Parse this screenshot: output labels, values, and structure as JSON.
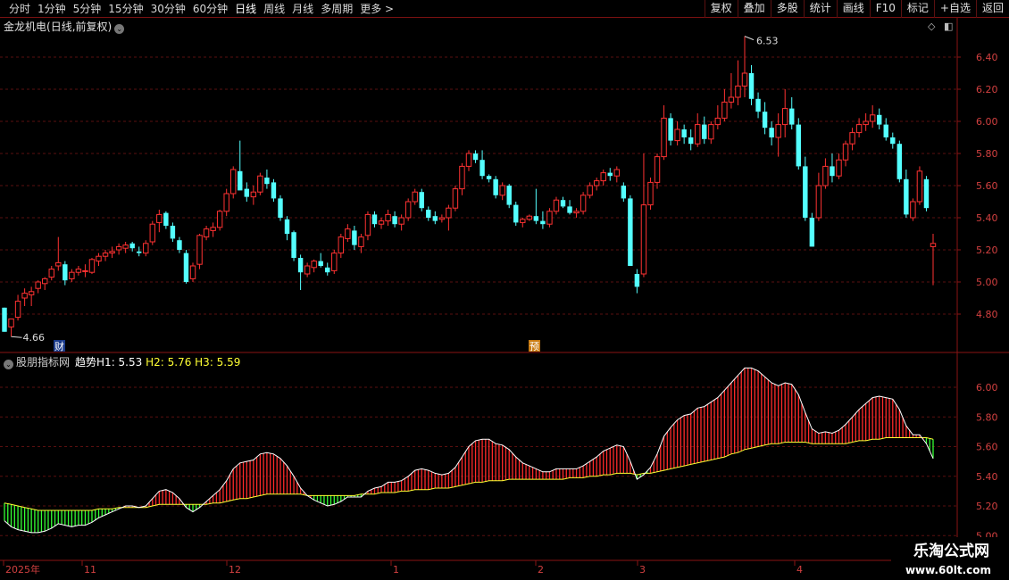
{
  "toolbar": {
    "periods": [
      "分时",
      "1分钟",
      "5分钟",
      "15分钟",
      "30分钟",
      "60分钟",
      "日线",
      "周线",
      "月线",
      "多周期",
      "更多 >"
    ],
    "active_period": "日线",
    "actions": [
      "复权",
      "叠加",
      "多股",
      "统计",
      "画线",
      "F10",
      "标记",
      "+自选",
      "返回"
    ]
  },
  "stock": {
    "name": "金龙机电",
    "title_suffix": "(日线,前复权)"
  },
  "main_chart": {
    "y_ticks": [
      "6.40",
      "6.20",
      "6.00",
      "5.80",
      "5.60",
      "5.40",
      "5.20",
      "5.00",
      "4.80"
    ],
    "high_label": "6.53",
    "low_label": "4.66",
    "badge_cai": "财",
    "badge_yu": "预",
    "up_color": "#ff3232",
    "down_color": "#54ffff"
  },
  "indicator": {
    "name": "股朋指标网",
    "trend_label": "趋势",
    "h1": "H1: 5.53",
    "h2": "H2: 5.76",
    "h3": "H3: 5.59",
    "y_ticks": [
      "6.00",
      "5.80",
      "5.60",
      "5.40",
      "5.20",
      "5.00"
    ],
    "rise_color": "#ff2a2a",
    "fall_color": "#33ff33",
    "h2_color": "#ffffff",
    "h3_color": "#ffff33"
  },
  "x_axis": {
    "labels": [
      "2025年",
      "11",
      "12",
      "1",
      "2",
      "3",
      "4"
    ]
  },
  "watermark": {
    "title": "乐淘公式网",
    "url": "www.60lt.com"
  },
  "chart_data": {
    "type": "candlestick",
    "ohlc": [
      [
        4.84,
        4.84,
        4.69,
        4.69
      ],
      [
        4.72,
        4.77,
        4.66,
        4.77
      ],
      [
        4.78,
        4.92,
        4.76,
        4.88
      ],
      [
        4.9,
        4.96,
        4.85,
        4.93
      ],
      [
        4.92,
        4.97,
        4.85,
        4.94
      ],
      [
        4.96,
        5.01,
        4.93,
        5.0
      ],
      [
        4.99,
        5.03,
        4.95,
        5.02
      ],
      [
        5.03,
        5.1,
        5.01,
        5.08
      ],
      [
        5.1,
        5.28,
        5.07,
        5.12
      ],
      [
        5.11,
        5.13,
        4.98,
        5.01
      ],
      [
        5.02,
        5.08,
        5.0,
        5.06
      ],
      [
        5.06,
        5.1,
        5.04,
        5.08
      ],
      [
        5.07,
        5.11,
        5.03,
        5.07
      ],
      [
        5.06,
        5.15,
        5.05,
        5.14
      ],
      [
        5.13,
        5.18,
        5.1,
        5.16
      ],
      [
        5.16,
        5.2,
        5.13,
        5.18
      ],
      [
        5.18,
        5.22,
        5.15,
        5.19
      ],
      [
        5.2,
        5.24,
        5.17,
        5.22
      ],
      [
        5.21,
        5.25,
        5.18,
        5.23
      ],
      [
        5.24,
        5.25,
        5.19,
        5.21
      ],
      [
        5.19,
        5.22,
        5.16,
        5.18
      ],
      [
        5.18,
        5.26,
        5.16,
        5.24
      ],
      [
        5.25,
        5.38,
        5.23,
        5.36
      ],
      [
        5.37,
        5.45,
        5.31,
        5.42
      ],
      [
        5.43,
        5.44,
        5.33,
        5.35
      ],
      [
        5.35,
        5.37,
        5.25,
        5.27
      ],
      [
        5.26,
        5.28,
        5.18,
        5.2
      ],
      [
        5.18,
        5.2,
        4.99,
        5.0
      ],
      [
        5.02,
        5.12,
        5.0,
        5.1
      ],
      [
        5.11,
        5.3,
        5.08,
        5.29
      ],
      [
        5.28,
        5.35,
        5.26,
        5.33
      ],
      [
        5.32,
        5.37,
        5.28,
        5.34
      ],
      [
        5.34,
        5.45,
        5.32,
        5.44
      ],
      [
        5.44,
        5.58,
        5.41,
        5.55
      ],
      [
        5.55,
        5.72,
        5.52,
        5.7
      ],
      [
        5.69,
        5.88,
        5.59,
        5.57
      ],
      [
        5.58,
        5.62,
        5.5,
        5.53
      ],
      [
        5.53,
        5.6,
        5.48,
        5.56
      ],
      [
        5.56,
        5.68,
        5.54,
        5.66
      ],
      [
        5.65,
        5.7,
        5.58,
        5.61
      ],
      [
        5.62,
        5.64,
        5.5,
        5.52
      ],
      [
        5.52,
        5.54,
        5.38,
        5.4
      ],
      [
        5.39,
        5.41,
        5.26,
        5.3
      ],
      [
        5.31,
        5.32,
        5.13,
        5.15
      ],
      [
        5.15,
        5.17,
        4.95,
        5.06
      ],
      [
        5.05,
        5.12,
        5.03,
        5.1
      ],
      [
        5.09,
        5.14,
        5.06,
        5.13
      ],
      [
        5.13,
        5.18,
        5.09,
        5.1
      ],
      [
        5.09,
        5.12,
        5.04,
        5.06
      ],
      [
        5.07,
        5.2,
        5.05,
        5.18
      ],
      [
        5.18,
        5.3,
        5.15,
        5.28
      ],
      [
        5.27,
        5.36,
        5.25,
        5.33
      ],
      [
        5.32,
        5.35,
        5.2,
        5.23
      ],
      [
        5.22,
        5.3,
        5.18,
        5.28
      ],
      [
        5.29,
        5.44,
        5.26,
        5.42
      ],
      [
        5.42,
        5.44,
        5.34,
        5.36
      ],
      [
        5.36,
        5.4,
        5.33,
        5.38
      ],
      [
        5.38,
        5.45,
        5.35,
        5.42
      ],
      [
        5.41,
        5.44,
        5.34,
        5.36
      ],
      [
        5.36,
        5.42,
        5.32,
        5.4
      ],
      [
        5.4,
        5.52,
        5.38,
        5.5
      ],
      [
        5.5,
        5.58,
        5.48,
        5.56
      ],
      [
        5.56,
        5.58,
        5.44,
        5.46
      ],
      [
        5.45,
        5.47,
        5.38,
        5.4
      ],
      [
        5.41,
        5.44,
        5.36,
        5.38
      ],
      [
        5.39,
        5.42,
        5.37,
        5.4
      ],
      [
        5.4,
        5.48,
        5.32,
        5.46
      ],
      [
        5.46,
        5.6,
        5.44,
        5.58
      ],
      [
        5.58,
        5.74,
        5.54,
        5.72
      ],
      [
        5.72,
        5.82,
        5.69,
        5.8
      ],
      [
        5.8,
        5.82,
        5.74,
        5.76
      ],
      [
        5.76,
        5.82,
        5.64,
        5.66
      ],
      [
        5.66,
        5.67,
        5.62,
        5.64
      ],
      [
        5.64,
        5.66,
        5.52,
        5.54
      ],
      [
        5.54,
        5.62,
        5.51,
        5.6
      ],
      [
        5.6,
        5.61,
        5.46,
        5.48
      ],
      [
        5.48,
        5.5,
        5.35,
        5.37
      ],
      [
        5.37,
        5.4,
        5.34,
        5.39
      ],
      [
        5.39,
        5.42,
        5.38,
        5.41
      ],
      [
        5.41,
        5.58,
        5.36,
        5.38
      ],
      [
        5.38,
        5.44,
        5.33,
        5.36
      ],
      [
        5.36,
        5.46,
        5.34,
        5.44
      ],
      [
        5.44,
        5.53,
        5.42,
        5.51
      ],
      [
        5.51,
        5.53,
        5.46,
        5.47
      ],
      [
        5.47,
        5.51,
        5.42,
        5.43
      ],
      [
        5.43,
        5.46,
        5.4,
        5.44
      ],
      [
        5.44,
        5.56,
        5.42,
        5.54
      ],
      [
        5.54,
        5.62,
        5.52,
        5.6
      ],
      [
        5.6,
        5.65,
        5.57,
        5.63
      ],
      [
        5.63,
        5.7,
        5.6,
        5.68
      ],
      [
        5.68,
        5.71,
        5.63,
        5.66
      ],
      [
        5.66,
        5.72,
        5.62,
        5.7
      ],
      [
        5.6,
        5.62,
        5.5,
        5.52
      ],
      [
        5.52,
        5.54,
        5.1,
        5.1
      ],
      [
        5.05,
        5.08,
        4.93,
        4.97
      ],
      [
        5.05,
        5.8,
        5.03,
        5.48
      ],
      [
        5.48,
        5.65,
        5.45,
        5.62
      ],
      [
        5.62,
        5.8,
        5.58,
        5.78
      ],
      [
        5.78,
        6.1,
        5.76,
        6.02
      ],
      [
        6.02,
        6.05,
        5.85,
        5.88
      ],
      [
        5.88,
        6.0,
        5.85,
        5.95
      ],
      [
        5.95,
        5.98,
        5.86,
        5.9
      ],
      [
        5.9,
        5.95,
        5.82,
        5.86
      ],
      [
        5.86,
        6.05,
        5.84,
        5.98
      ],
      [
        5.98,
        6.03,
        5.86,
        5.89
      ],
      [
        5.89,
        6.0,
        5.86,
        5.98
      ],
      [
        5.98,
        6.1,
        5.95,
        6.02
      ],
      [
        6.02,
        6.2,
        6.0,
        6.12
      ],
      [
        6.12,
        6.3,
        6.08,
        6.15
      ],
      [
        6.15,
        6.38,
        6.1,
        6.22
      ],
      [
        6.22,
        6.53,
        6.15,
        6.3
      ],
      [
        6.3,
        6.35,
        6.1,
        6.14
      ],
      [
        6.14,
        6.18,
        6.02,
        6.06
      ],
      [
        6.06,
        6.12,
        5.92,
        5.96
      ],
      [
        5.96,
        6.0,
        5.85,
        5.9
      ],
      [
        5.9,
        6.05,
        5.78,
        5.98
      ],
      [
        5.98,
        6.2,
        5.9,
        6.08
      ],
      [
        6.08,
        6.15,
        5.95,
        5.98
      ],
      [
        5.98,
        6.02,
        5.7,
        5.72
      ],
      [
        5.72,
        5.78,
        5.38,
        5.4
      ],
      [
        5.4,
        5.43,
        5.22,
        5.22
      ],
      [
        5.4,
        5.68,
        5.38,
        5.6
      ],
      [
        5.6,
        5.77,
        5.58,
        5.72
      ],
      [
        5.72,
        5.8,
        5.62,
        5.66
      ],
      [
        5.66,
        5.8,
        5.64,
        5.76
      ],
      [
        5.76,
        5.88,
        5.72,
        5.86
      ],
      [
        5.86,
        5.96,
        5.82,
        5.93
      ],
      [
        5.93,
        6.02,
        5.9,
        5.98
      ],
      [
        5.98,
        6.05,
        5.94,
        6.0
      ],
      [
        6.0,
        6.1,
        5.96,
        6.04
      ],
      [
        6.04,
        6.08,
        5.95,
        5.98
      ],
      [
        5.98,
        6.02,
        5.88,
        5.9
      ],
      [
        5.9,
        5.93,
        5.83,
        5.86
      ],
      [
        5.86,
        5.88,
        5.62,
        5.64
      ],
      [
        5.64,
        5.7,
        5.4,
        5.42
      ],
      [
        5.4,
        5.52,
        5.38,
        5.5
      ],
      [
        5.5,
        5.72,
        5.48,
        5.69
      ],
      [
        5.64,
        5.66,
        5.44,
        5.46
      ],
      [
        5.22,
        5.3,
        4.98,
        5.24
      ]
    ],
    "ma_h2": [
      5.1,
      5.06,
      5.04,
      5.03,
      5.02,
      5.02,
      5.03,
      5.05,
      5.08,
      5.07,
      5.06,
      5.07,
      5.07,
      5.09,
      5.12,
      5.14,
      5.16,
      5.18,
      5.2,
      5.2,
      5.19,
      5.2,
      5.25,
      5.3,
      5.31,
      5.29,
      5.25,
      5.19,
      5.16,
      5.19,
      5.23,
      5.27,
      5.31,
      5.37,
      5.45,
      5.49,
      5.5,
      5.51,
      5.55,
      5.56,
      5.55,
      5.52,
      5.47,
      5.4,
      5.32,
      5.27,
      5.24,
      5.22,
      5.2,
      5.21,
      5.23,
      5.26,
      5.26,
      5.26,
      5.3,
      5.32,
      5.33,
      5.36,
      5.36,
      5.37,
      5.4,
      5.44,
      5.45,
      5.44,
      5.42,
      5.41,
      5.42,
      5.46,
      5.53,
      5.6,
      5.64,
      5.65,
      5.65,
      5.62,
      5.61,
      5.58,
      5.53,
      5.49,
      5.47,
      5.45,
      5.43,
      5.43,
      5.45,
      5.45,
      5.45,
      5.45,
      5.47,
      5.5,
      5.53,
      5.57,
      5.59,
      5.61,
      5.6,
      5.5,
      5.38,
      5.41,
      5.46,
      5.55,
      5.67,
      5.73,
      5.78,
      5.81,
      5.82,
      5.86,
      5.87,
      5.9,
      5.93,
      5.98,
      6.03,
      6.08,
      6.13,
      6.13,
      6.11,
      6.07,
      6.03,
      6.01,
      6.03,
      6.02,
      5.95,
      5.83,
      5.72,
      5.69,
      5.7,
      5.69,
      5.71,
      5.75,
      5.8,
      5.85,
      5.89,
      5.93,
      5.94,
      5.93,
      5.92,
      5.85,
      5.74,
      5.68,
      5.68,
      5.62,
      5.52
    ],
    "ma_h3": [
      5.22,
      5.21,
      5.2,
      5.19,
      5.18,
      5.17,
      5.17,
      5.17,
      5.17,
      5.17,
      5.17,
      5.17,
      5.17,
      5.17,
      5.18,
      5.18,
      5.18,
      5.19,
      5.19,
      5.19,
      5.19,
      5.19,
      5.2,
      5.21,
      5.21,
      5.21,
      5.21,
      5.21,
      5.21,
      5.21,
      5.21,
      5.22,
      5.22,
      5.23,
      5.24,
      5.25,
      5.25,
      5.26,
      5.27,
      5.28,
      5.28,
      5.28,
      5.28,
      5.28,
      5.28,
      5.27,
      5.27,
      5.27,
      5.27,
      5.27,
      5.27,
      5.27,
      5.27,
      5.28,
      5.28,
      5.28,
      5.29,
      5.29,
      5.29,
      5.3,
      5.3,
      5.31,
      5.31,
      5.31,
      5.32,
      5.32,
      5.32,
      5.33,
      5.34,
      5.35,
      5.36,
      5.36,
      5.37,
      5.37,
      5.37,
      5.38,
      5.38,
      5.38,
      5.38,
      5.38,
      5.38,
      5.38,
      5.38,
      5.38,
      5.39,
      5.39,
      5.39,
      5.4,
      5.4,
      5.41,
      5.41,
      5.42,
      5.42,
      5.42,
      5.41,
      5.42,
      5.42,
      5.43,
      5.44,
      5.45,
      5.46,
      5.47,
      5.48,
      5.49,
      5.5,
      5.51,
      5.52,
      5.53,
      5.55,
      5.56,
      5.58,
      5.59,
      5.6,
      5.61,
      5.62,
      5.62,
      5.63,
      5.63,
      5.63,
      5.63,
      5.62,
      5.62,
      5.62,
      5.62,
      5.62,
      5.62,
      5.63,
      5.64,
      5.64,
      5.65,
      5.65,
      5.66,
      5.66,
      5.66,
      5.66,
      5.66,
      5.66,
      5.66,
      5.65
    ]
  }
}
